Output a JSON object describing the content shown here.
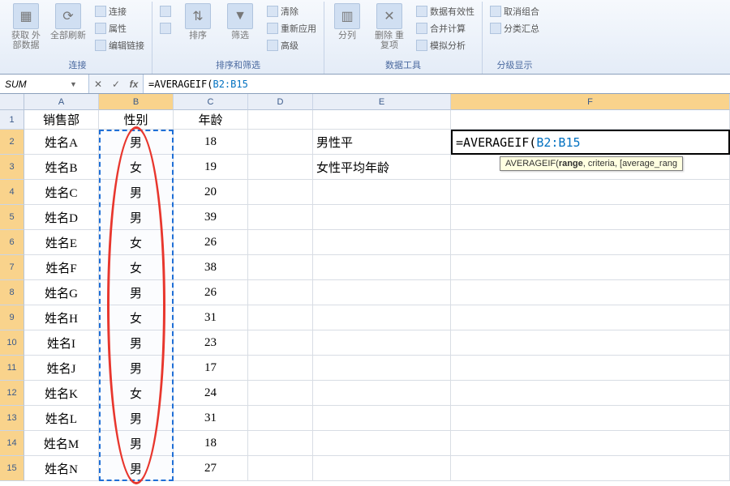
{
  "ribbon": {
    "groups": [
      {
        "label": "连接",
        "big": [
          {
            "name": "get-data",
            "label": "获取\n外部数据"
          },
          {
            "name": "refresh-all",
            "label": "全部刷新"
          }
        ],
        "stack": [
          "连接",
          "属性",
          "编辑链接"
        ]
      },
      {
        "label": "排序和筛选",
        "big": [
          {
            "name": "sort-az",
            "label": ""
          },
          {
            "name": "sort",
            "label": "排序"
          },
          {
            "name": "filter",
            "label": "筛选"
          }
        ],
        "stack": [
          "清除",
          "重新应用",
          "高级"
        ]
      },
      {
        "label": "数据工具",
        "big": [
          {
            "name": "text-to-columns",
            "label": "分列"
          },
          {
            "name": "remove-dupes",
            "label": "删除\n重复项"
          }
        ],
        "right": [
          "数据有效性",
          "合并计算",
          "模拟分析"
        ]
      },
      {
        "label": "分级显示",
        "stack": [
          "取消组合",
          "分类汇总"
        ]
      }
    ]
  },
  "namebox": "SUM",
  "formula_prefix": "=AVERAGEIF(",
  "formula_ref": "B2:B15",
  "tooltip": {
    "func": "AVERAGEIF",
    "sig": "(range, criteria, [average_rang",
    "bold": "range"
  },
  "cols": [
    "A",
    "B",
    "C",
    "D",
    "E",
    "F"
  ],
  "col_widths": {
    "A": 92,
    "B": 92,
    "C": 92,
    "D": 80,
    "E": 170,
    "F": 344
  },
  "headers": {
    "A": "销售部",
    "B": "性别",
    "C": "年龄"
  },
  "rows": [
    {
      "n": "姓名A",
      "s": "男",
      "a": 18
    },
    {
      "n": "姓名B",
      "s": "女",
      "a": 19
    },
    {
      "n": "姓名C",
      "s": "男",
      "a": 20
    },
    {
      "n": "姓名D",
      "s": "男",
      "a": 39
    },
    {
      "n": "姓名E",
      "s": "女",
      "a": 26
    },
    {
      "n": "姓名F",
      "s": "女",
      "a": 38
    },
    {
      "n": "姓名G",
      "s": "男",
      "a": 26
    },
    {
      "n": "姓名H",
      "s": "女",
      "a": 31
    },
    {
      "n": "姓名I",
      "s": "男",
      "a": 23
    },
    {
      "n": "姓名J",
      "s": "男",
      "a": 17
    },
    {
      "n": "姓名K",
      "s": "女",
      "a": 24
    },
    {
      "n": "姓名L",
      "s": "男",
      "a": 31
    },
    {
      "n": "姓名M",
      "s": "男",
      "a": 18
    },
    {
      "n": "姓名N",
      "s": "男",
      "a": 27
    }
  ],
  "side_labels": {
    "E2": "男性平",
    "E3": "女性平均年龄"
  },
  "edit_cell": {
    "prefix": "=AVERAGEIF(",
    "ref": "B2:B15"
  },
  "first_row_num": 1
}
